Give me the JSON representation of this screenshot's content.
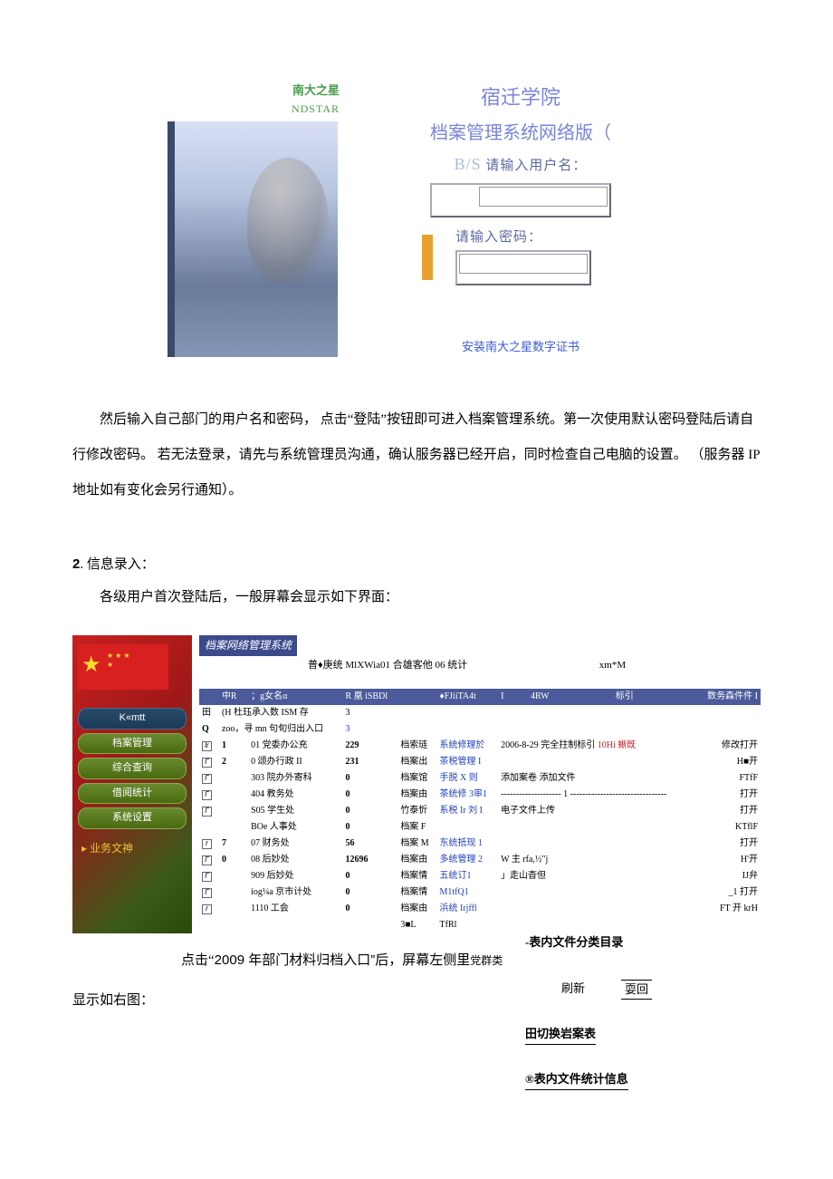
{
  "login": {
    "brand_cn": "南大之星",
    "brand_en": "NDSTAR",
    "title_main": "宿迁学院",
    "title_sub": "档案管理系统网络版（",
    "bs_label": "B/S",
    "user_label": "请输入用户名：",
    "pass_label": "请输入密码：",
    "cert_link": "安装南大之星数字证书"
  },
  "para1": "然后输入自己部门的用户名和密码， 点击“登陆”按钮即可进入档案管理系统。第一次使用默认密码登陆后请自行修改密码。 若无法登录，请先与系统管理员沟通，确认服务器已经开启，同时检查自己电脑的设置。 （服务器 IP 地址如有变化会另行通知）。",
  "section2": {
    "num": "2",
    "title": ". 信息录入：",
    "desc": "各级用户首次登陆后，一般屏幕会显示如下界面："
  },
  "dashboard": {
    "title": "档案网络管理系统",
    "crumb": "普♦庚统 MlXWia01 合雄客他 06 统计",
    "crumb_right": "xm*M",
    "sidebar": {
      "items": [
        "K«mtt",
        "档案管理",
        "综合查询",
        "借阅统计",
        "系统设置"
      ],
      "caption": "业务文神"
    },
    "header_cells": [
      "",
      "中R",
      "；g女名α",
      "R 凰 iSBDl",
      "",
      "♦FJiiTA4t",
      "I",
      "4RW",
      "标引",
      "数务森件件 I"
    ],
    "row_a": {
      "mark": "田",
      "text": "(H 杜珏承入数 ISM 存",
      "num": "3"
    },
    "row_b": {
      "mark": "Q",
      "text": "zoo，寻 mn 句旬归出入口",
      "num": "3"
    },
    "rows": [
      {
        "cb": "lr",
        "n": "1",
        "dept": "01 党委办公充",
        "num": "229",
        "c4": "档索琏",
        "c5": "系统修理於",
        "c6": "2006-8-29 完全拄制标引",
        "c6r": "10Hi 蜥既",
        "act": "修改打开"
      },
      {
        "cb": "Γ",
        "n": "2",
        "dept": "0 颂办行政 II",
        "num": "231",
        "c4": "档案出",
        "c5": "茶税管理 I",
        "c6": "",
        "c6r": "",
        "act": "H■开"
      },
      {
        "cb": "Γ",
        "n": "",
        "dept": "303 院办外寄科",
        "num": "0",
        "c4": "档案馆",
        "c5": "手脱 X 则",
        "c6": "添加案卷",
        "c6r": "添加文件",
        "act": "FTfF"
      },
      {
        "cb": "Γ",
        "n": "",
        "dept": "404 教务处",
        "num": "0",
        "c4": "档案由",
        "c5": "茶统修 3审1",
        "c6": "-------------------- 1 --------------------------------",
        "c6r": "",
        "act": "打开"
      },
      {
        "cb": "Γ",
        "n": "",
        "dept": "S05 学生处",
        "num": "0",
        "c4": "竹泰忻",
        "c5": "系税 Ir 刘 I",
        "c6": "电子文件上传",
        "c6r": "",
        "act": "打开"
      },
      {
        "cb": "",
        "n": "",
        "dept": "BOe 人事处",
        "num": "0",
        "c4": "档案 F",
        "c5": "",
        "c6": "",
        "c6r": "",
        "act": "KTflF"
      },
      {
        "cb": "r",
        "n": "7",
        "dept": "07 财务处",
        "num": "56",
        "c4": "档案 M",
        "c5": "东统抵现 1",
        "c6": "",
        "c6r": "",
        "act": "打开"
      },
      {
        "cb": "Γ",
        "n": "0",
        "dept": "08 后妙处",
        "num": "12696",
        "c4": "档案由",
        "c5": "多统管理 2",
        "c6": "W 主 rfa,½\"j",
        "c6r": "",
        "act": "H'开"
      },
      {
        "cb": "Γ",
        "n": "",
        "dept": "909 后妙处",
        "num": "0",
        "c4": "档案情",
        "c5": "五统订1",
        "c6": "」走山杳但",
        "c6r": "",
        "act": "IJ弁"
      },
      {
        "cb": "Γ",
        "n": "",
        "dept": "iog¼a 京市计处",
        "num": "0",
        "c4": "档案情",
        "c5": "M1tfQ1",
        "c6": "",
        "c6r": "",
        "act": "_1 打开"
      },
      {
        "cb": "r",
        "n": "",
        "dept": "1110 工会",
        "num": "0",
        "c4": "档案由",
        "c5": "浜统 Irjffl",
        "c6": "",
        "c6r": "",
        "act": "FT 开 krH"
      }
    ],
    "tail": {
      "c4": "3■L",
      "c5": "TfRl"
    }
  },
  "after_dash": {
    "line1_a": "点击“",
    "line1_b": "2009 年部门材料归档入口”后，屏幕左侧里",
    "line1_c": "党群类",
    "line2": "显示如右图："
  },
  "right_panel": {
    "h1": "-表内文件分类目录",
    "refresh": "刷新",
    "back": "耍回",
    "h2": "田切换岩案表",
    "h3": "®表内文件统计信息"
  }
}
